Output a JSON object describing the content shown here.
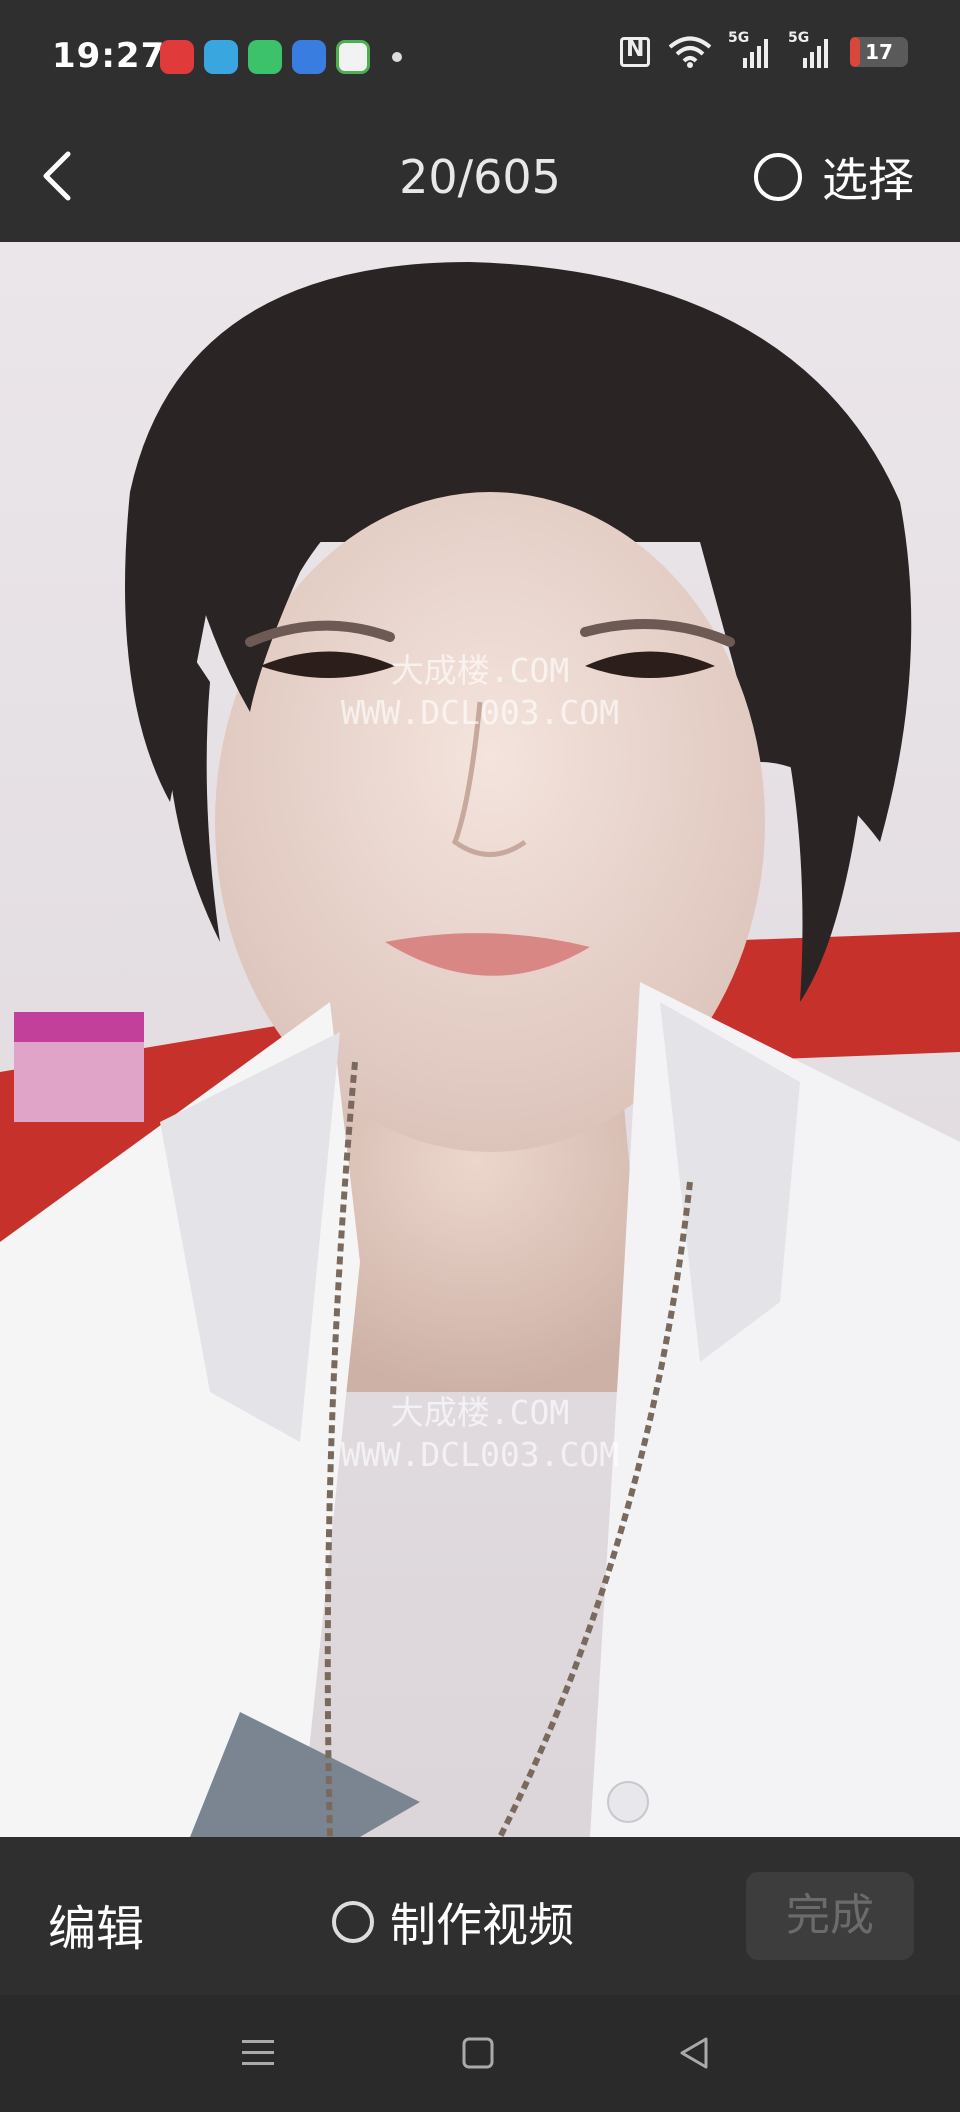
{
  "status_bar": {
    "time": "19:27",
    "network_1": "5G",
    "network_2": "5G",
    "battery_level": "17",
    "battery_fraction": 0.17
  },
  "header": {
    "photo_counter": "20/605",
    "select_label": "选择"
  },
  "photo": {
    "watermark_1": [
      "大成楼.COM",
      "WWW.DCL003.COM"
    ],
    "watermark_2": [
      "大成楼.COM",
      "WWW.DCL003.COM"
    ]
  },
  "actions": {
    "edit_label": "编辑",
    "make_video_label": "制作视频",
    "done_label": "完成"
  },
  "icons": {
    "back": "chevron-left-icon",
    "menu": "menu-icon",
    "home": "home-icon",
    "recents_back": "back-triangle-icon"
  },
  "colors": {
    "bar_background": "#2f2f2f",
    "battery_low": "#d9473a",
    "done_disabled_text": "#6b6b6b"
  }
}
